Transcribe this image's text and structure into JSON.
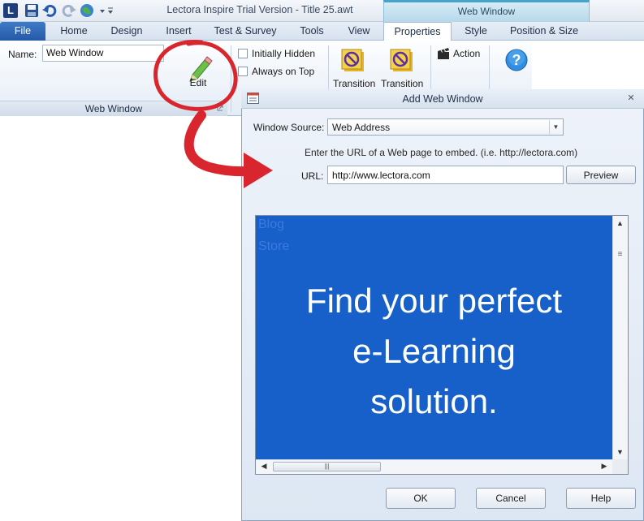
{
  "titlebar": {
    "title": "Lectora Inspire Trial Version - Title 25.awt",
    "context_title": "Web Window",
    "logo_letter": "L"
  },
  "tabs": [
    {
      "label": "File"
    },
    {
      "label": "Home"
    },
    {
      "label": "Design"
    },
    {
      "label": "Insert"
    },
    {
      "label": "Test & Survey"
    },
    {
      "label": "Tools"
    },
    {
      "label": "View"
    },
    {
      "label": "Properties"
    },
    {
      "label": "Style"
    },
    {
      "label": "Position & Size"
    }
  ],
  "ribbon": {
    "name_label": "Name:",
    "name_value": "Web Window",
    "edit_label": "Edit",
    "initially_hidden_label": "Initially Hidden",
    "always_on_top_label": "Always on Top",
    "transition1_label": "Transition",
    "transition2_label": "Transition",
    "action_label": "Action",
    "group_label": "Web Window"
  },
  "dialog": {
    "title": "Add Web Window",
    "window_source_label": "Window Source:",
    "window_source_value": "Web Address",
    "url_hint": "Enter the URL of a Web page to embed. (i.e. http://lectora.com)",
    "url_label": "URL:",
    "url_value": "http://www.lectora.com",
    "preview_button": "Preview",
    "preview": {
      "link1": "Blog",
      "link2": "Store",
      "hero_line1": "Find your perfect",
      "hero_line2": "e-Learning",
      "hero_line3": "solution."
    },
    "ok_button": "OK",
    "cancel_button": "Cancel",
    "help_button": "Help"
  },
  "colors": {
    "accent": "#2559a6",
    "preview_bg": "#1760c9",
    "annotation": "#d9262e"
  }
}
